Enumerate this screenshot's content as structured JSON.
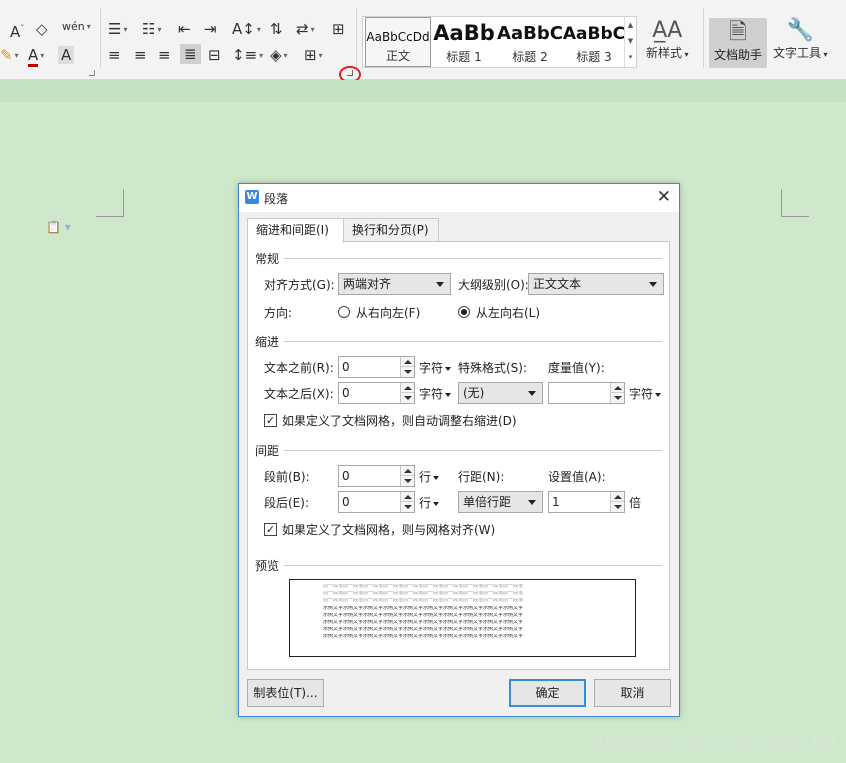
{
  "ribbon": {
    "font_row1": [
      "A˜",
      "⌫",
      "wén"
    ],
    "styles": [
      {
        "preview": "AaBbCcDd",
        "name": "正文"
      },
      {
        "preview": "AaBb",
        "name": "标题 1"
      },
      {
        "preview": "AaBbC",
        "name": "标题 2"
      },
      {
        "preview": "AaBbC",
        "name": "标题 3"
      }
    ],
    "new_style": "新样式",
    "doc_helper": "文档助手",
    "text_tools": "文字工具"
  },
  "dialog": {
    "title": "段落",
    "tabs": [
      "缩进和间距(I)",
      "换行和分页(P)"
    ],
    "general": {
      "heading": "常规",
      "align_label": "对齐方式(G):",
      "align_value": "两端对齐",
      "outline_label": "大纲级别(O):",
      "outline_value": "正文文本",
      "direction_label": "方向:",
      "rtl_label": "从右向左(F)",
      "ltr_label": "从左向右(L)",
      "direction_selected": "ltr"
    },
    "indent": {
      "heading": "缩进",
      "before_label": "文本之前(R):",
      "before_value": "0",
      "before_unit": "字符",
      "after_label": "文本之后(X):",
      "after_value": "0",
      "after_unit": "字符",
      "special_label": "特殊格式(S):",
      "special_value": "(无)",
      "measure_label": "度量值(Y):",
      "measure_value": "",
      "measure_unit": "字符",
      "grid_check_label": "如果定义了文档网格，则自动调整右缩进(D)",
      "grid_checked": true
    },
    "spacing": {
      "heading": "间距",
      "before_label": "段前(B):",
      "before_value": "0",
      "before_unit": "行",
      "after_label": "段后(E):",
      "after_value": "0",
      "after_unit": "行",
      "line_label": "行距(N):",
      "line_value": "单倍行距",
      "setting_label": "设置值(A):",
      "setting_value": "1",
      "setting_unit": "倍",
      "grid_check_label": "如果定义了文档网格，则与网格对齐(W)",
      "grid_checked": true
    },
    "preview": {
      "heading": "预览",
      "prev_text": "前一段落前一段落前一段落前一段落前一段落前一段落前一段落前一段落前一段落前一段落",
      "sample_text": "示例文字示例文字示例文字示例文字示例文字示例文字示例文字示例文字示例文字示例文字"
    },
    "buttons": {
      "tabs_button": "制表位(T)...",
      "ok": "确定",
      "cancel": "取消"
    }
  },
  "watermark": "https://blog.csdn.net/qq_45067799",
  "colors": {
    "doc_background": "#cfe8cc",
    "dialog_border": "#3a8ad6",
    "highlight_circle": "#e02020"
  }
}
